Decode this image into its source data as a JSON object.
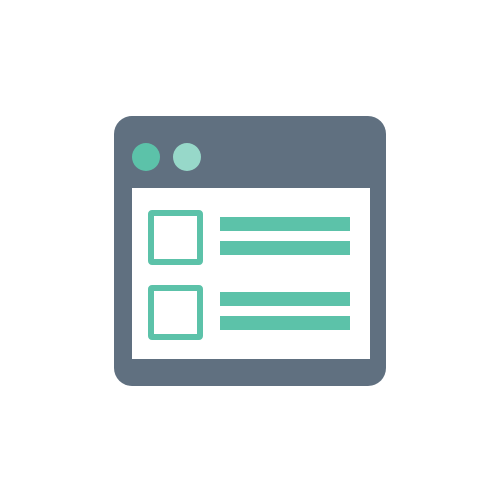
{
  "colors": {
    "frame": "#607080",
    "panel": "#ffffff",
    "accent": "#5cc2a9",
    "dot_1": "#5cc2a9",
    "dot_2": "#97d8c9"
  },
  "icons": {
    "window": "browser-window-icon",
    "list_item_checkbox": "checkbox-icon",
    "text_line": "text-line-icon"
  },
  "list": {
    "items": [
      {
        "checked": false
      },
      {
        "checked": false
      }
    ]
  }
}
